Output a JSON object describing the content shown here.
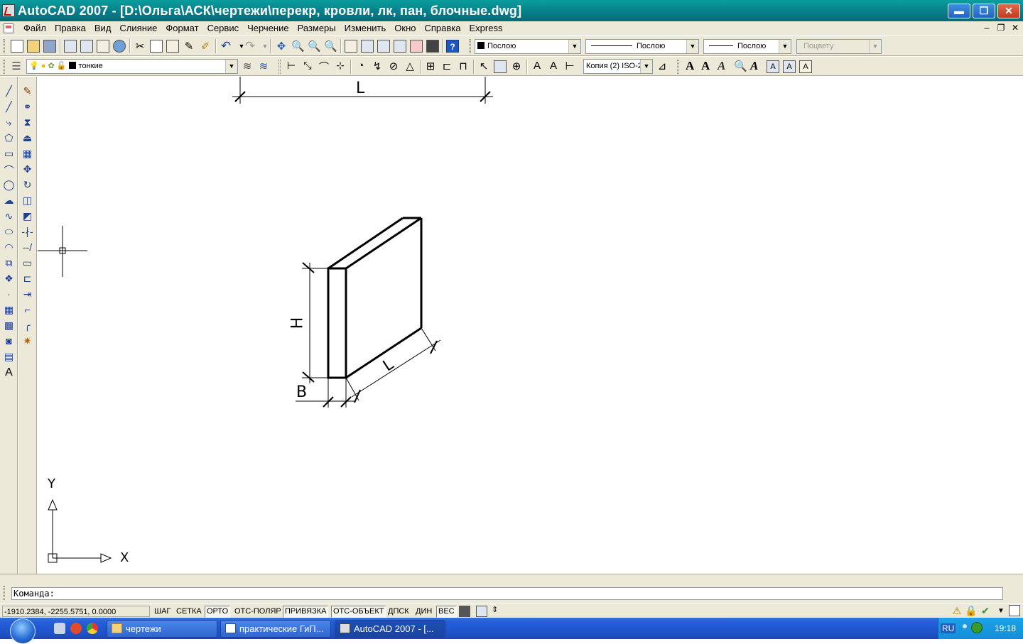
{
  "window": {
    "title": "AutoCAD 2007 - [D:\\Ольга\\АСК\\чертежи\\перекр, кровли, лк, пан, блочные.dwg]",
    "minimize": "▬",
    "restore": "❐",
    "close": "✕"
  },
  "menu": {
    "items": [
      "Файл",
      "Правка",
      "Вид",
      "Слияние",
      "Формат",
      "Сервис",
      "Черчение",
      "Размеры",
      "Изменить",
      "Окно",
      "Справка",
      "Express"
    ],
    "mdi_minimize": "–",
    "mdi_restore": "❐",
    "mdi_close": "✕"
  },
  "properties": {
    "color": "Послою",
    "linetype": "Послою",
    "lineweight": "Послою",
    "plotstyle": "Поцвету"
  },
  "layers": {
    "current": "тонкие"
  },
  "dimstyle": {
    "current": "Копия (2) ISO-2"
  },
  "drawing": {
    "dim_top": "L",
    "dim_height": "H",
    "dim_diag": "L",
    "dim_width": "B",
    "ucs_x": "X",
    "ucs_y": "Y"
  },
  "command": {
    "prompt": "Команда:"
  },
  "status": {
    "coords": "-1910.2384, -2255.5751, 0.0000",
    "buttons": [
      "ШАГ",
      "СЕТКА",
      "ОРТО",
      "ОТС-ПОЛЯР",
      "ПРИВЯЗКА",
      "ОТС-ОБЪЕКТ",
      "ДПСК",
      "ДИН",
      "ВЕС"
    ]
  },
  "taskbar": {
    "tasks": [
      "чертежи",
      "практические ГиП...",
      "AutoCAD 2007 - [..."
    ],
    "lang": "RU",
    "clock": "19:18"
  },
  "colors": {
    "titlebar": "#087e8a",
    "ui_face": "#ece9d8",
    "taskbar": "#245edb"
  }
}
